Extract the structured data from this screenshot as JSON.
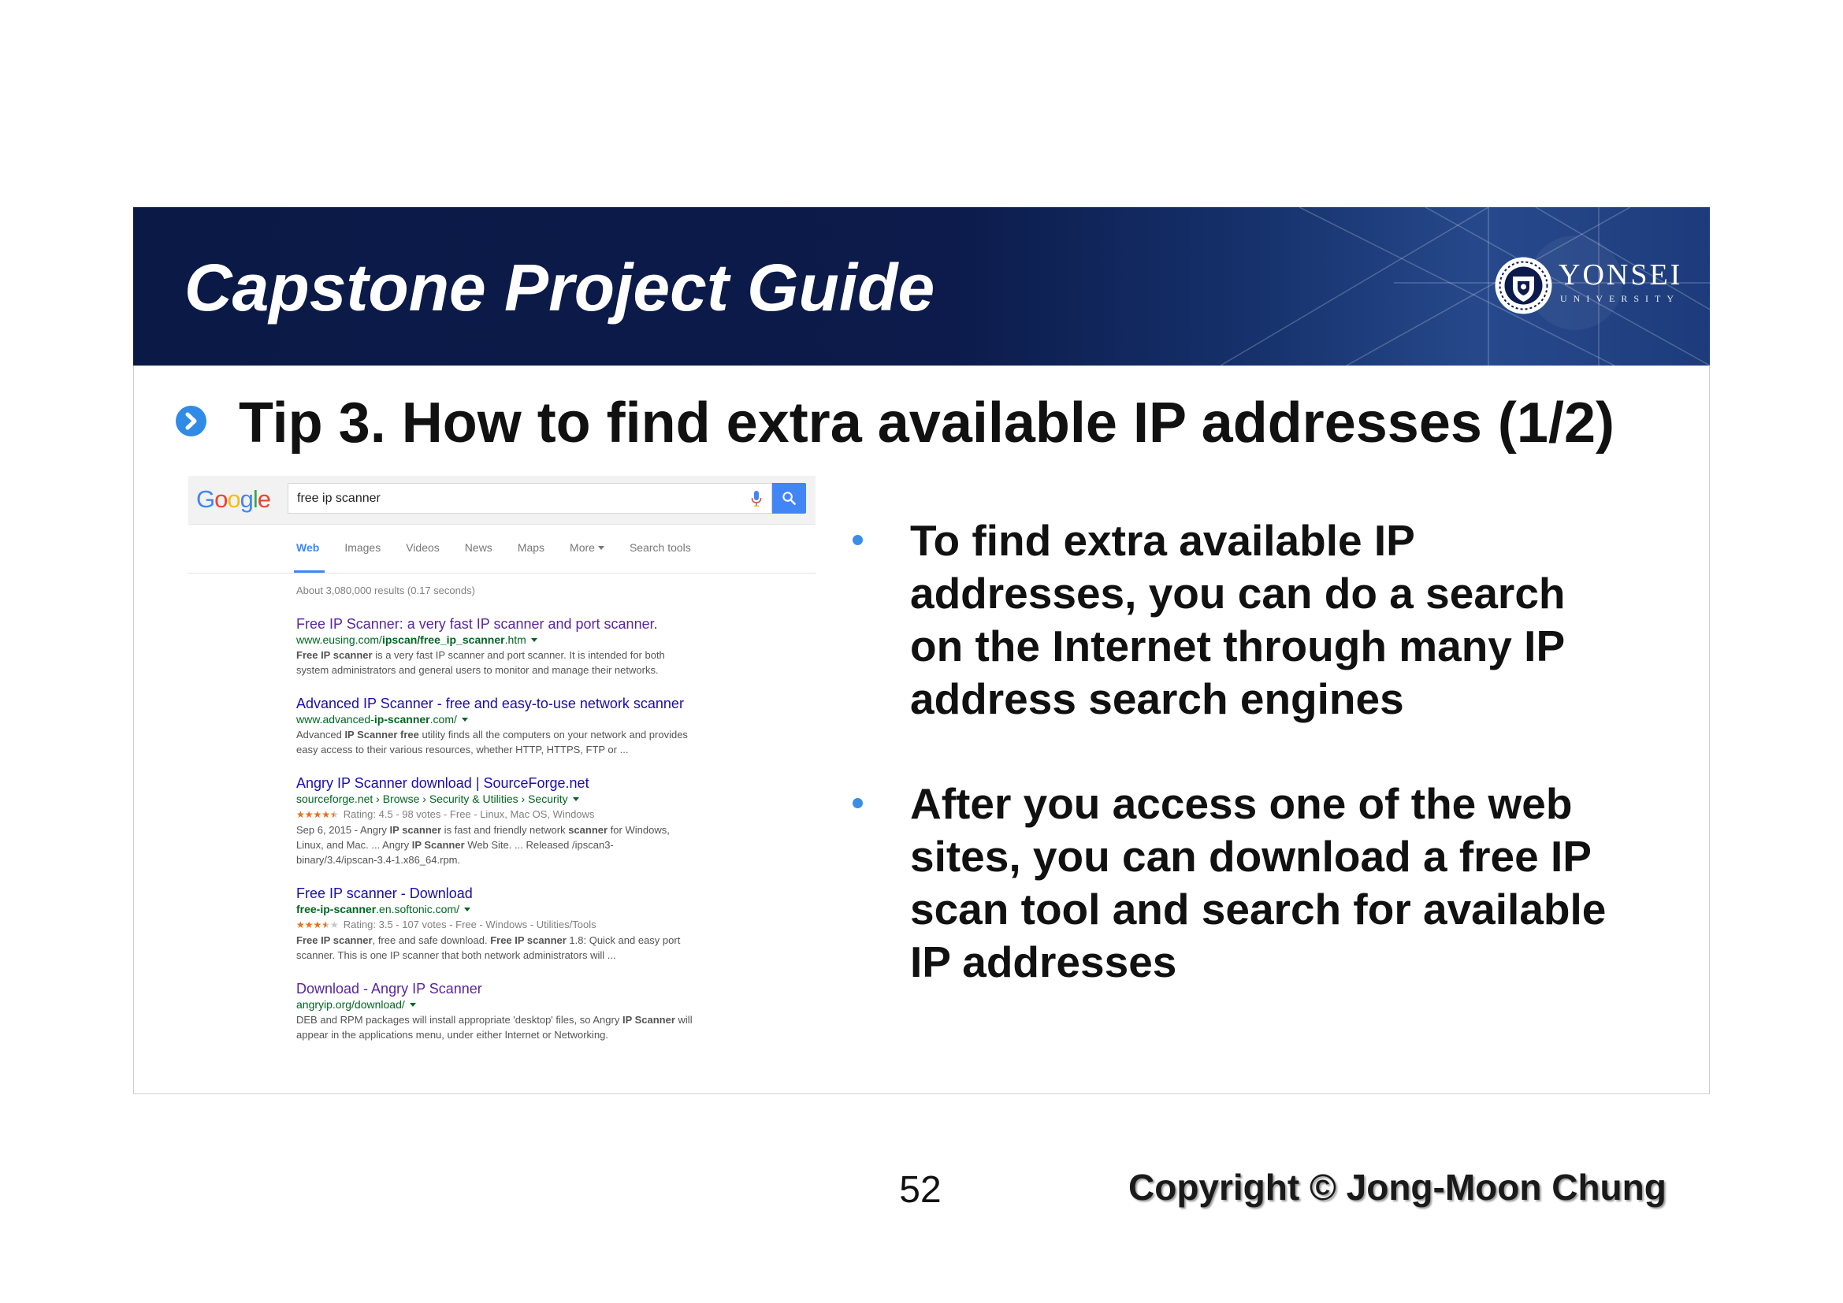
{
  "slide": {
    "title": "Capstone Project Guide",
    "logo": {
      "name": "YONSEI",
      "subtitle": "UNIVERSITY",
      "icon": "university-crest-icon"
    },
    "heading_icon": "chevron-right-circle-icon",
    "heading": "Tip 3. How to find extra available IP addresses (1/2)",
    "bullets": [
      "To find extra available IP addresses, you can do a search on the Internet through many IP address search engines",
      "After you access one of the web sites, you can download a free IP scan tool and search for available IP addresses"
    ],
    "page_number": "52",
    "copyright": "Copyright © Jong-Moon Chung"
  },
  "search": {
    "logo": {
      "letters": [
        "G",
        "o",
        "o",
        "g",
        "l",
        "e"
      ],
      "colors": [
        "#4285F4",
        "#EA4335",
        "#FBBC05",
        "#4285F4",
        "#34A853",
        "#EA4335"
      ]
    },
    "query": "free ip scanner",
    "icons": {
      "voice": "microphone-icon",
      "submit": "search-icon"
    },
    "tabs": [
      {
        "label": "Web"
      },
      {
        "label": "Images"
      },
      {
        "label": "Videos"
      },
      {
        "label": "News"
      },
      {
        "label": "Maps"
      },
      {
        "label": "More"
      },
      {
        "label": "Search tools"
      }
    ],
    "active_tab": "Web",
    "result_stats": "About 3,080,000 results (0.17 seconds)",
    "results": [
      {
        "title": "Free IP Scanner: a very fast IP scanner and port scanner.",
        "visited": true,
        "url": [
          {
            "t": "www.eusing.com/"
          },
          {
            "t": "ipscan/free_ip_scanner",
            "b": true
          },
          {
            "t": ".htm"
          }
        ],
        "rating": null,
        "snippet": [
          [
            {
              "t": "Free IP scanner",
              "b": true
            },
            {
              "t": " is a very fast IP scanner and port scanner. It is intended for both"
            }
          ],
          [
            {
              "t": "system administrators and general users to monitor and manage their networks."
            }
          ]
        ]
      },
      {
        "title": "Advanced IP Scanner - free and easy-to-use network scanner",
        "visited": false,
        "url": [
          {
            "t": "www.advanced-"
          },
          {
            "t": "ip-scanner",
            "b": true
          },
          {
            "t": ".com/"
          }
        ],
        "rating": null,
        "snippet": [
          [
            {
              "t": "Advanced "
            },
            {
              "t": "IP Scanner free",
              "b": true
            },
            {
              "t": " utility finds all the computers on your network and provides"
            }
          ],
          [
            {
              "t": "easy access to their various resources, whether HTTP, HTTPS, FTP or ..."
            }
          ]
        ]
      },
      {
        "title": "Angry IP Scanner download | SourceForge.net",
        "visited": false,
        "url": [
          {
            "t": "sourceforge.net › Browse › Security & Utilities › Security"
          }
        ],
        "rating": {
          "stars": 4.5,
          "text": "Rating: 4.5 - 98 votes - Free - Linux, Mac OS, Windows"
        },
        "snippet": [
          [
            {
              "t": "Sep 6, 2015 - Angry "
            },
            {
              "t": "IP scanner",
              "b": true
            },
            {
              "t": " is fast and friendly network "
            },
            {
              "t": "scanner",
              "b": true
            },
            {
              "t": " for Windows,"
            }
          ],
          [
            {
              "t": "Linux, and Mac. ... Angry "
            },
            {
              "t": "IP Scanner",
              "b": true
            },
            {
              "t": " Web Site. ... Released /ipscan3-"
            }
          ],
          [
            {
              "t": "binary/3.4/ipscan-3.4-1.x86_64.rpm."
            }
          ]
        ]
      },
      {
        "title": "Free IP scanner - Download",
        "visited": false,
        "url": [
          {
            "t": "free-ip-scanner",
            "b": true
          },
          {
            "t": ".en.softonic.com/"
          }
        ],
        "rating": {
          "stars": 3.5,
          "text": "Rating: 3.5 - 107 votes - Free - Windows - Utilities/Tools"
        },
        "snippet": [
          [
            {
              "t": "Free IP scanner",
              "b": true
            },
            {
              "t": ", free and safe download. "
            },
            {
              "t": "Free IP scanner",
              "b": true
            },
            {
              "t": " 1.8: Quick and easy port"
            }
          ],
          [
            {
              "t": "scanner. This is one IP scanner that both network administrators will ..."
            }
          ]
        ]
      },
      {
        "title": "Download - Angry IP Scanner",
        "visited": true,
        "url": [
          {
            "t": "angryip.org/download/"
          }
        ],
        "rating": null,
        "snippet": [
          [
            {
              "t": "DEB and RPM packages will install appropriate 'desktop' files, so Angry "
            },
            {
              "t": "IP Scanner",
              "b": true
            },
            {
              "t": " will"
            }
          ],
          [
            {
              "t": "appear in the applications menu, under either Internet or Networking."
            }
          ]
        ]
      }
    ]
  },
  "colors": {
    "header_bg": "#0c1b4b",
    "accent": "#3a8ee6",
    "link": "#1a0dab",
    "visited_link": "#5a259e",
    "url_green": "#006621",
    "star": "#e7711b"
  }
}
